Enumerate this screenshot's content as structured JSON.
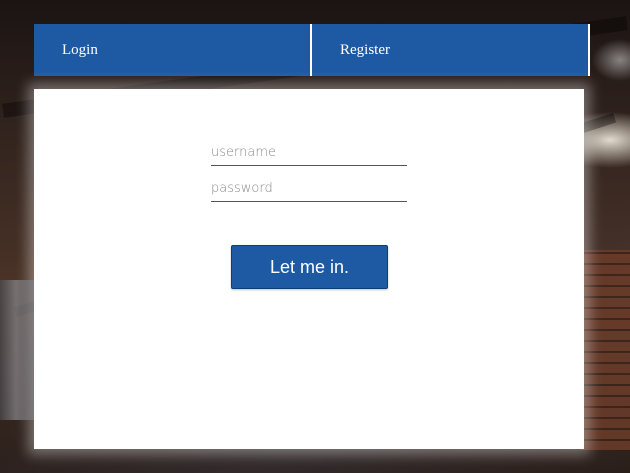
{
  "tabs": {
    "login_label": "Login",
    "register_label": "Register"
  },
  "form": {
    "username_placeholder": "username",
    "password_placeholder": "password",
    "submit_label": "Let me in."
  },
  "colors": {
    "accent": "#1d5aa3",
    "panel": "#ffffff"
  }
}
